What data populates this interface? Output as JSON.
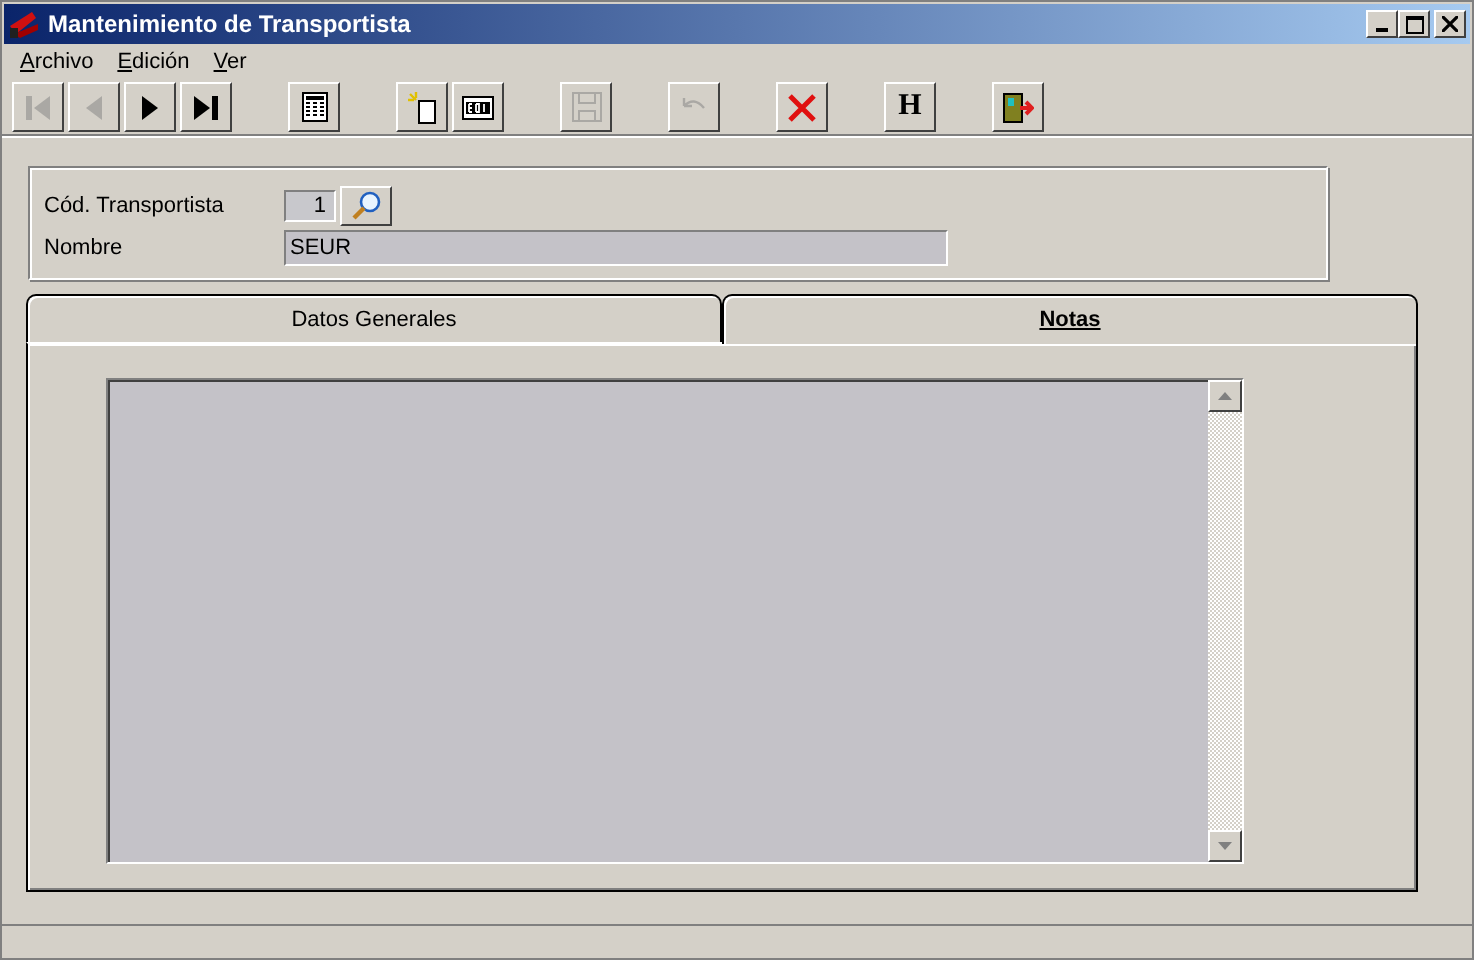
{
  "window": {
    "title": "Mantenimiento de Transportista"
  },
  "menu": [
    {
      "accel": "A",
      "rest": "rchivo"
    },
    {
      "accel": "E",
      "rest": "dición"
    },
    {
      "accel": "V",
      "rest": "er"
    }
  ],
  "toolbar": [
    [
      {
        "kind": "first",
        "disabled": true
      },
      {
        "kind": "prev",
        "disabled": true
      },
      {
        "kind": "next",
        "disabled": false
      },
      {
        "kind": "last",
        "disabled": false
      }
    ],
    [
      {
        "kind": "grid",
        "disabled": false
      }
    ],
    [
      {
        "kind": "new",
        "disabled": false
      },
      {
        "kind": "edit",
        "disabled": false
      }
    ],
    [
      {
        "kind": "save",
        "disabled": true
      }
    ],
    [
      {
        "kind": "undo",
        "disabled": true
      }
    ],
    [
      {
        "kind": "delete",
        "disabled": false
      }
    ],
    [
      {
        "kind": "text",
        "label": "H",
        "disabled": false
      }
    ],
    [
      {
        "kind": "exit",
        "disabled": false
      }
    ]
  ],
  "form": {
    "code_label": "Cód. Transportista",
    "code_value": "1",
    "name_label": "Nombre",
    "name_value": "SEUR"
  },
  "tabs": [
    {
      "label": "Datos Generales",
      "selected": false
    },
    {
      "label": "Notas",
      "selected": true
    }
  ]
}
